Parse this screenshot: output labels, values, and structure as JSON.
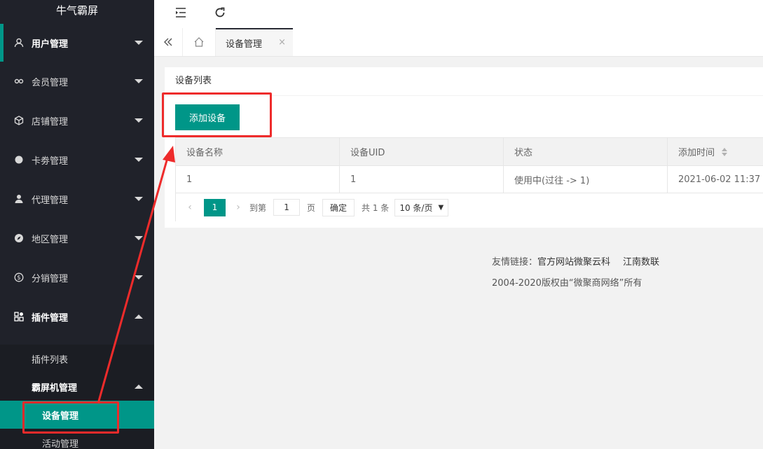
{
  "app": {
    "title": "牛气霸屏"
  },
  "sidebar": {
    "items": [
      {
        "label": "用户管理",
        "icon": "user-icon"
      },
      {
        "label": "会员管理",
        "icon": "link-icon"
      },
      {
        "label": "店铺管理",
        "icon": "box-icon"
      },
      {
        "label": "卡劵管理",
        "icon": "circle-icon"
      },
      {
        "label": "代理管理",
        "icon": "person-icon"
      },
      {
        "label": "地区管理",
        "icon": "compass-icon"
      },
      {
        "label": "分销管理",
        "icon": "dollar-icon"
      },
      {
        "label": "插件管理",
        "icon": "apps-icon"
      }
    ],
    "plugin_sub": {
      "list": "插件列表",
      "screen": "霸屏机管理",
      "device": "设备管理",
      "activity": "活动管理"
    }
  },
  "header": {
    "menu_icon": "menu-fold-icon",
    "refresh_icon": "refresh-icon"
  },
  "tabs": {
    "active": "设备管理",
    "close": "×"
  },
  "card": {
    "title": "设备列表",
    "add_button": "添加设备"
  },
  "table": {
    "columns": [
      "设备名称",
      "设备UID",
      "状态",
      "添加时间"
    ],
    "rows": [
      [
        "1",
        "1",
        "使用中(过往 -> 1)",
        "2021-06-02 11:37"
      ]
    ]
  },
  "pager": {
    "current": "1",
    "goto_label": "到第",
    "goto_value": "1",
    "page_unit": "页",
    "confirm": "确定",
    "total": "共 1 条",
    "page_size": "10 条/页"
  },
  "footer": {
    "links_label": "友情链接：",
    "link1": "官方网站微聚云科",
    "link2": "江南数联",
    "copyright": "2004-2020版权由“微聚商网络”所有"
  },
  "colors": {
    "accent": "#009688",
    "sidebar": "#20222a",
    "annotation": "#ee2b2b"
  }
}
